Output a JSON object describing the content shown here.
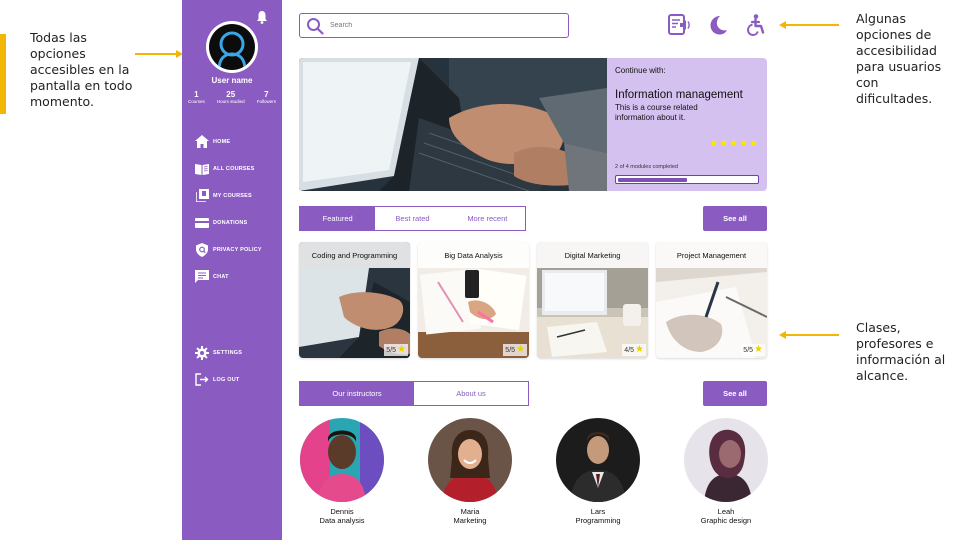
{
  "annotations": {
    "left_note": "Todas las opciones accesibles en la pantalla en todo momento.",
    "right_note_top": "Algunas opciones de accesibilidad para usuarios con dificultades.",
    "right_note_bottom": "Clases, profesores e información al alcance."
  },
  "colors": {
    "accent": "#8a5cc2",
    "panel": "#d4c1ef",
    "annotation": "#f2b705",
    "star": "#ffe500"
  },
  "sidebar": {
    "username": "User name",
    "stats": [
      {
        "value": "1",
        "label": "Courses"
      },
      {
        "value": "25",
        "label": "Hours studied"
      },
      {
        "value": "7",
        "label": "Followers"
      }
    ],
    "nav": [
      {
        "label": "HOME",
        "icon": "home-icon"
      },
      {
        "label": "ALL COURSES",
        "icon": "book-open-icon"
      },
      {
        "label": "MY COURSES",
        "icon": "library-icon"
      },
      {
        "label": "DONATIONS",
        "icon": "card-icon"
      },
      {
        "label": "PRIVACY POLICY",
        "icon": "shield-icon"
      },
      {
        "label": "CHAT",
        "icon": "chat-icon"
      }
    ],
    "bottom": [
      {
        "label": "SETTINGS",
        "icon": "gear-icon"
      },
      {
        "label": "LOG OUT",
        "icon": "logout-icon"
      }
    ]
  },
  "search": {
    "placeholder": "Search"
  },
  "top_icons": [
    "read-aloud-icon",
    "dark-mode-icon",
    "accessibility-icon"
  ],
  "hero": {
    "continue_label": "Continue with:",
    "course_title": "Information management",
    "course_desc": "This is a course related information about it.",
    "stars": "★★★★★",
    "modules_text": "2 of 4 modules completed",
    "progress": 0.5
  },
  "course_tabs": [
    "Featured",
    "Best rated",
    "More recent"
  ],
  "see_all": "See all",
  "courses": [
    {
      "title": "Coding and Programming",
      "rating": "5/5"
    },
    {
      "title": "Big Data Analysis",
      "rating": "5/5"
    },
    {
      "title": "Digital Marketing",
      "rating": "4/5"
    },
    {
      "title": "Project Management",
      "rating": "5/5"
    }
  ],
  "info_tabs": [
    "Our instructors",
    "About us"
  ],
  "instructors": [
    {
      "name": "Dennis",
      "role": "Data analysis"
    },
    {
      "name": "Maria",
      "role": "Marketing"
    },
    {
      "name": "Lars",
      "role": "Programming"
    },
    {
      "name": "Leah",
      "role": "Graphic design"
    }
  ]
}
